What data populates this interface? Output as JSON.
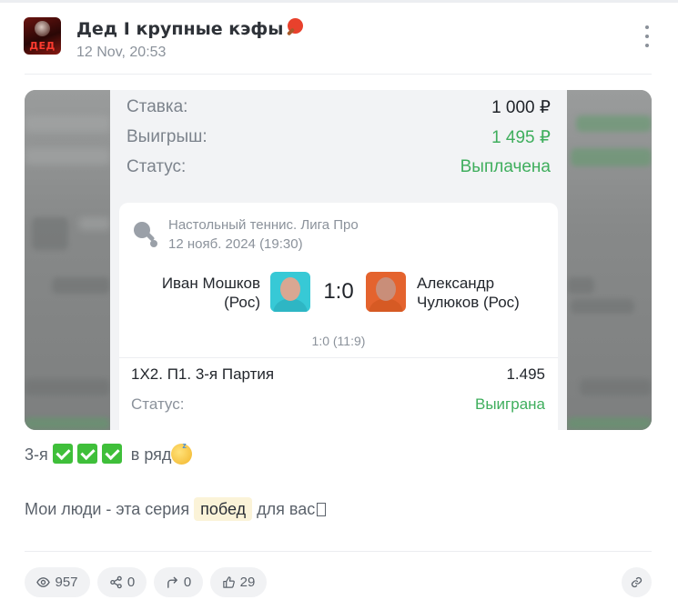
{
  "post": {
    "channel_title": "Дед I крупные кэфы",
    "avatar_text": "ДЕД",
    "date": "12 Nov, 20:53"
  },
  "receipt": {
    "stake_label": "Ставка:",
    "stake_value": "1 000 ₽",
    "win_label": "Выигрыш:",
    "win_value": "1 495 ₽",
    "status_label": "Статус:",
    "status_value": "Выплачена"
  },
  "bet": {
    "league": "Настольный теннис. Лига Про",
    "match_date": "12 нояб. 2024 (19:30)",
    "player_left_line1": "Иван Мошков",
    "player_left_line2": "(Рос)",
    "score": "1:0",
    "player_right_line1": "Александр",
    "player_right_line2": "Чулюков (Рос)",
    "set_score": "1:0 (11:9)",
    "market": "1X2. П1. 3-я Партия",
    "odds": "1.495",
    "status_label": "Статус:",
    "status_value": "Выиграна"
  },
  "text": {
    "line1_prefix": "3-я",
    "line1_suffix": "в ряд",
    "line2_before": "Мои люди - эта серия",
    "line2_highlight": "побед",
    "line2_after": "для вас"
  },
  "stats": {
    "views": "957",
    "shares": "0",
    "forwards": "0",
    "likes": "29"
  },
  "colors": {
    "accent_green": "#3fae5d",
    "check_green": "#3fbf3a",
    "highlight_bg": "#fbf3d8"
  },
  "icons": [
    "menu-dots-icon",
    "ping-pong-icon",
    "eye-icon",
    "share-icon",
    "forward-icon",
    "thumbs-up-icon",
    "link-icon",
    "check-icon",
    "sleeping-face-icon"
  ]
}
